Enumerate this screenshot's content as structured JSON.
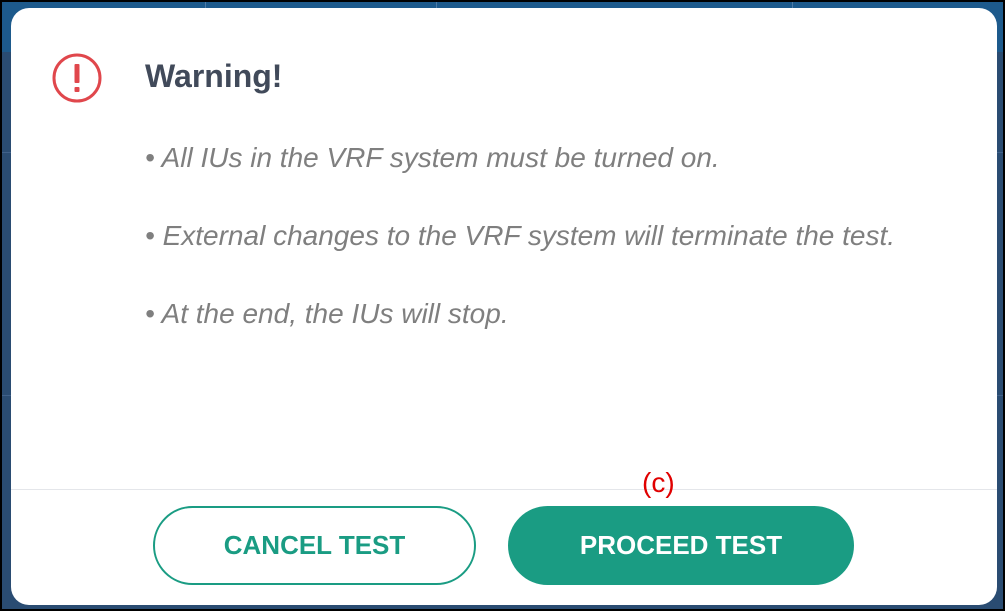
{
  "dialog": {
    "title": "Warning!",
    "icon": "exclamation-circle-icon",
    "bullets": [
      "• All IUs in the VRF system must be turned on.",
      "• External changes to the VRF system will terminate the test.",
      "• At the end, the IUs will stop."
    ],
    "cancel_label": "CANCEL TEST",
    "proceed_label": "PROCEED TEST"
  },
  "annotation": {
    "label": "(c)"
  },
  "colors": {
    "accent": "#1a9c83",
    "warning_icon": "#e0474c",
    "title_text": "#414a5a",
    "body_text": "#7f7f7f",
    "annotation": "#e00000"
  }
}
